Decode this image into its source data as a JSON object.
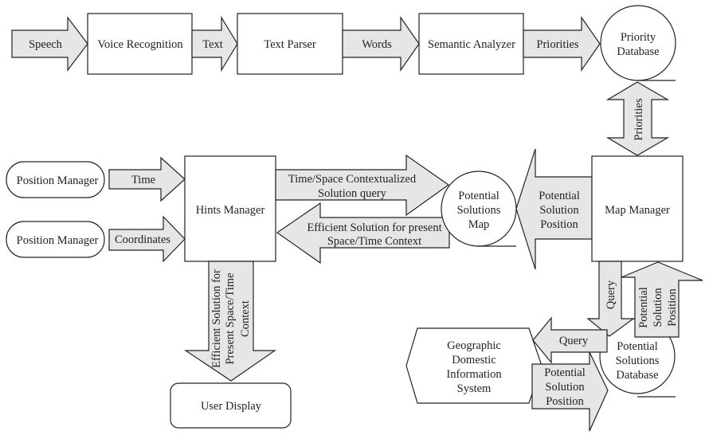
{
  "nodes": {
    "voice_recognition": "Voice Recognition",
    "text_parser": "Text Parser",
    "semantic_analyzer": "Semantic Analyzer",
    "priority_database": [
      "Priority",
      "Database"
    ],
    "position_manager_1": "Position Manager",
    "position_manager_2": "Position Manager",
    "hints_manager": "Hints Manager",
    "potential_solutions_map": [
      "Potential",
      "Solutions",
      "Map"
    ],
    "map_manager": "Map Manager",
    "potential_solutions_database": [
      "Potential",
      "Solutions",
      "Database"
    ],
    "geographic_system": [
      "Geographic",
      "Domestic",
      "Information",
      "System"
    ],
    "user_display": "User Display"
  },
  "edges": {
    "speech": "Speech",
    "text": "Text",
    "words": "Words",
    "priorities_h": "Priorities",
    "priorities_v": "Priorities",
    "time": "Time",
    "coordinates": "Coordinates",
    "contextualized_query": [
      "Time/Space Contextualized",
      "Solution query"
    ],
    "efficient_solution": [
      "Efficient Solution for present",
      "Space/Time Context"
    ],
    "potential_solution_position_left": [
      "Potential",
      "Solution",
      "Position"
    ],
    "query_down": "Query",
    "potential_solution_position_up": [
      "Potential",
      "Solution",
      "Position"
    ],
    "query_left": "Query",
    "potential_solution_position_right": [
      "Potential",
      "Solution",
      "Position"
    ],
    "efficient_solution_down": [
      "Efficient Solution for",
      "Present Space/Time",
      "Context"
    ]
  }
}
